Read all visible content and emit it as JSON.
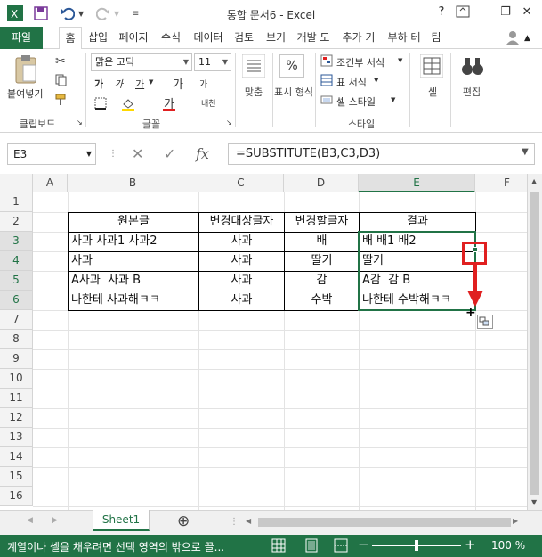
{
  "window": {
    "title": "통합 문서6 - Excel",
    "help": "?",
    "minimize": "—",
    "restore": "❐",
    "close": "✕"
  },
  "tabs": {
    "file": "파일",
    "items": [
      "홈",
      "삽입",
      "페이지",
      "수식",
      "데이터",
      "검토",
      "보기",
      "개발 도",
      "추가 기",
      "부하 테",
      "팀"
    ],
    "active_index": 0
  },
  "ribbon": {
    "clipboard": {
      "paste": "붙여넣기",
      "label": "클립보드"
    },
    "font": {
      "name": "맑은 고딕",
      "size": "11",
      "bold": "가",
      "italic": "가",
      "underline": "가",
      "grow": "가",
      "shrink": "가",
      "color": "가",
      "phonetic": "내천",
      "label": "글꼴"
    },
    "alignment": {
      "label": "맞춤"
    },
    "number": {
      "label": "표시 형식",
      "percent": "%"
    },
    "styles": {
      "conditional": "조건부 서식",
      "table": "표 서식",
      "cell_style": "셀 스타일",
      "label": "스타일"
    },
    "cells": {
      "label": "셀"
    },
    "editing": {
      "label": "편집"
    }
  },
  "formula_bar": {
    "name_box": "E3",
    "formula": "=SUBSTITUTE(B3,C3,D3)",
    "cancel": "✕",
    "enter": "✓",
    "fx": "fx"
  },
  "grid": {
    "columns": [
      "A",
      "B",
      "C",
      "D",
      "E",
      "F"
    ],
    "selected_column": "E",
    "rows": [
      "1",
      "2",
      "3",
      "4",
      "5",
      "6",
      "7",
      "8",
      "9",
      "10",
      "11",
      "12",
      "13",
      "14",
      "15",
      "16"
    ],
    "selected_rows": [
      "3",
      "4",
      "5",
      "6"
    ],
    "table": {
      "headers": [
        "원본글",
        "변경대상글자",
        "변경할글자",
        "결과"
      ],
      "rows": [
        [
          "사과 사과1 사과2",
          "사과",
          "배",
          "배 배1 배2"
        ],
        [
          "사과",
          "사과",
          "딸기",
          "딸기"
        ],
        [
          "A사과  사과 B",
          "사과",
          "감",
          "A감  감 B"
        ],
        [
          "나한테 사과해ㅋㅋ",
          "사과",
          "수박",
          "나한테 수박해ㅋㅋ"
        ]
      ]
    }
  },
  "sheets": {
    "active": "Sheet1",
    "add": "⊕"
  },
  "status": {
    "message": "계열이나 셀을 채우려면 선택 영역의 밖으로 끌...",
    "zoom": "100 %",
    "zoom_minus": "−",
    "zoom_plus": "+"
  },
  "colors": {
    "excel_green": "#217346",
    "annotation_red": "#e02020"
  }
}
